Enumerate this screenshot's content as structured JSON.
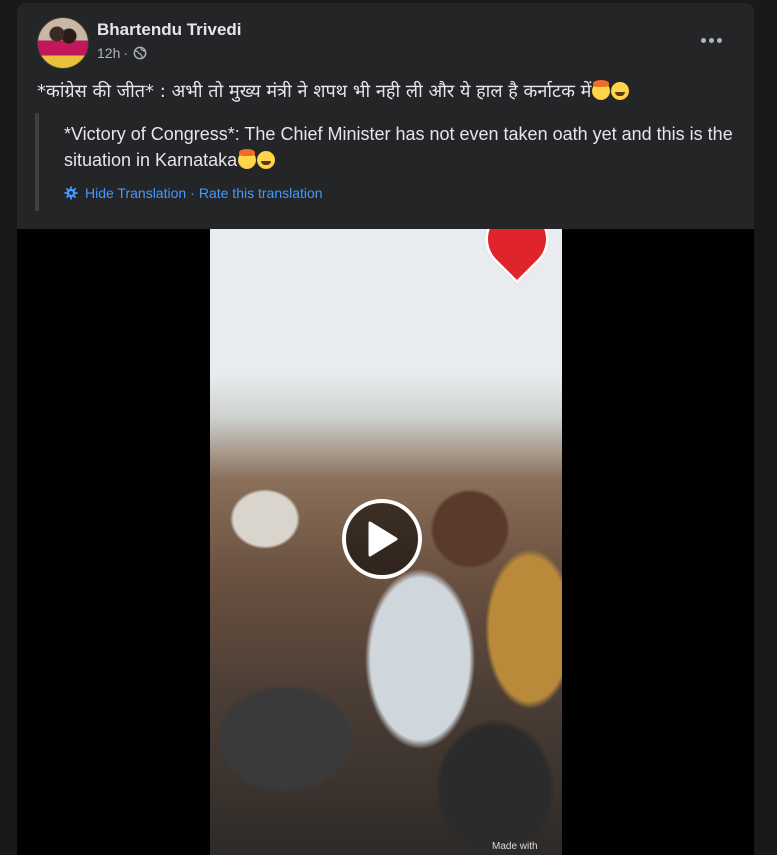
{
  "post": {
    "author": "Bhartendu Trivedi",
    "time": "12h",
    "dot": "·",
    "privacy_icon": "globe-icon",
    "text": "*कांग्रेस की जीत* : अभी तो मुख्य मंत्री ने शपथ भी नही ली और ये हाल है कर्नाटक में",
    "text_emojis": [
      "exploding-head-emoji",
      "smiling-face-emoji"
    ]
  },
  "translation": {
    "text": "*Victory of Congress*: The Chief Minister has not even taken oath yet and this is the situation in Karnataka",
    "emojis": [
      "exploding-head-emoji",
      "smiling-face-emoji"
    ],
    "hide_label": "Hide Translation",
    "separator": "·",
    "rate_label": "Rate this translation"
  },
  "video": {
    "watermark": "Made with",
    "play_icon": "play-icon"
  },
  "colors": {
    "background": "#18191a",
    "card": "#242526",
    "link": "#4599ff",
    "pin": "#e0242b"
  }
}
